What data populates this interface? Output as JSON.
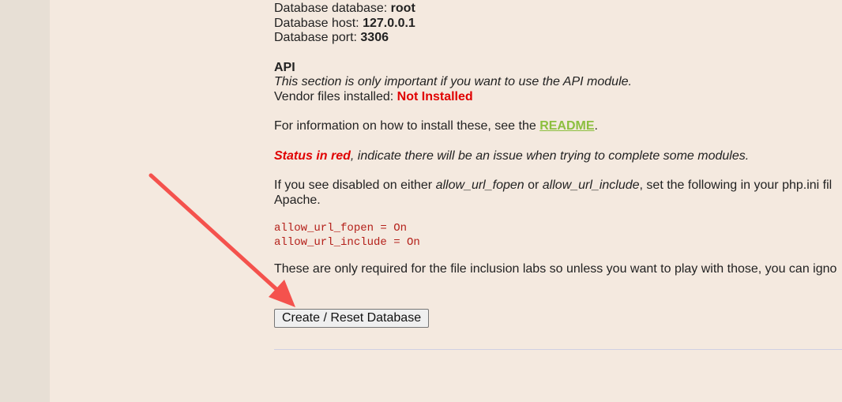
{
  "db": {
    "database_label": "Database database: ",
    "database_value": "root",
    "host_label": "Database host: ",
    "host_value": "127.0.0.1",
    "port_label": "Database port: ",
    "port_value": "3306"
  },
  "api": {
    "title": "API",
    "note": "This section is only important if you want to use the API module.",
    "vendor_label": "Vendor files installed: ",
    "vendor_value": "Not Installed"
  },
  "readme_info": {
    "prefix": "For information on how to install these, see the ",
    "link": "README",
    "suffix": "."
  },
  "status_note": {
    "red": "Status in red",
    "rest": ", indicate there will be an issue when trying to complete some modules."
  },
  "url_info": {
    "part1": "If you see disabled on either ",
    "fopen": "allow_url_fopen",
    "part2": " or ",
    "include": "allow_url_include",
    "part3": ", set the following in your php.ini fil",
    "line2": "Apache."
  },
  "code_lines": [
    "allow_url_fopen = On",
    "allow_url_include = On"
  ],
  "inclusion_note": "These are only required for the file inclusion labs so unless you want to play with those, you can igno",
  "button": {
    "label": "Create / Reset Database"
  },
  "colors": {
    "background": "#f4e9df",
    "not_installed": "#e00000",
    "readme_link": "#8cbf3f",
    "code": "#b4201a",
    "arrow": "#f4524d"
  }
}
